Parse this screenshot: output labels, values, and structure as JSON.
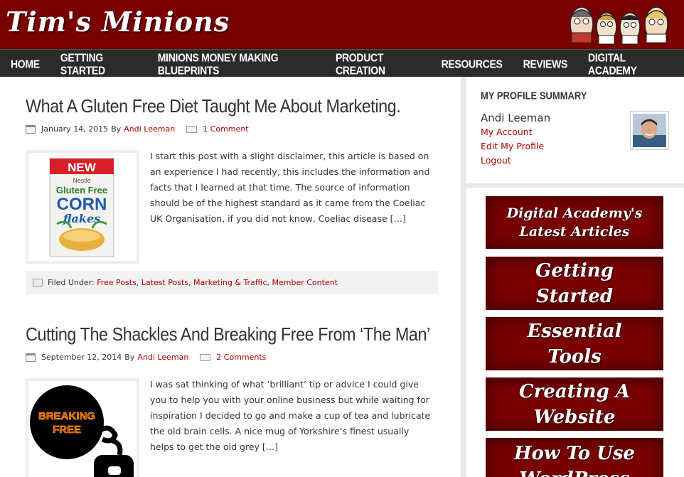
{
  "site": {
    "logo": "Tim's Minions"
  },
  "nav": [
    "HOME",
    "GETTING STARTED",
    "MINIONS MONEY MAKING BLUEPRINTS",
    "PRODUCT CREATION",
    "RESOURCES",
    "REVIEWS",
    "DIGITAL ACADEMY"
  ],
  "posts": [
    {
      "title": "What A Gluten Free Diet Taught Me About Marketing.",
      "date": "January 14, 2015",
      "by": "By",
      "author": "Andi Leeman",
      "comments": "1 Comment",
      "excerpt": "I start this post with a slight disclaimer, this article is based on an experience I had recently, this includes the information and facts that I learned at that time. The source of information should be of the highest standard as it came from the Coeliac UK Organisation, if you did not know, Coeliac disease […]",
      "filed_label": "Filed Under:",
      "categories": [
        "Free Posts",
        "Latest Posts",
        "Marketing & Traffic",
        "Member Content"
      ],
      "thumb": {
        "new": "NEW",
        "brand": "Nestlé",
        "line1": "Gluten Free",
        "line2": "CORN",
        "line3": "flakes"
      }
    },
    {
      "title": "Cutting The Shackles And Breaking Free From ‘The Man’",
      "date": "September 12, 2014",
      "by": "By",
      "author": "Andi Leeman",
      "comments": "2 Comments",
      "excerpt": "I was sat thinking of what ‘brilliant’ tip or advice I could give you to help you with your online business but while waiting for inspiration I decided to go and make a cup of tea and lubricate the old brain cells. A nice mug of Yorkshire’s finest usually helps to get the old grey […]",
      "thumb": {
        "line1": "BREAKING",
        "line2": "FREE"
      }
    }
  ],
  "profile": {
    "title": "MY PROFILE SUMMARY",
    "name": "Andi Leeman",
    "links": [
      "My Account",
      "Edit My Profile",
      "Logout"
    ]
  },
  "banners": [
    {
      "line1": "Digital Academy's",
      "line2": "Latest Articles"
    },
    {
      "line1": "Getting",
      "line2": "Started"
    },
    {
      "line1": "Essential",
      "line2": "Tools"
    },
    {
      "line1": "Creating A",
      "line2": "Website"
    },
    {
      "line1": "How To Use",
      "line2": "WordPress"
    }
  ],
  "colors": {
    "header": "#7a0000",
    "nav": "#2b2b2b",
    "link": "#aa0000"
  }
}
